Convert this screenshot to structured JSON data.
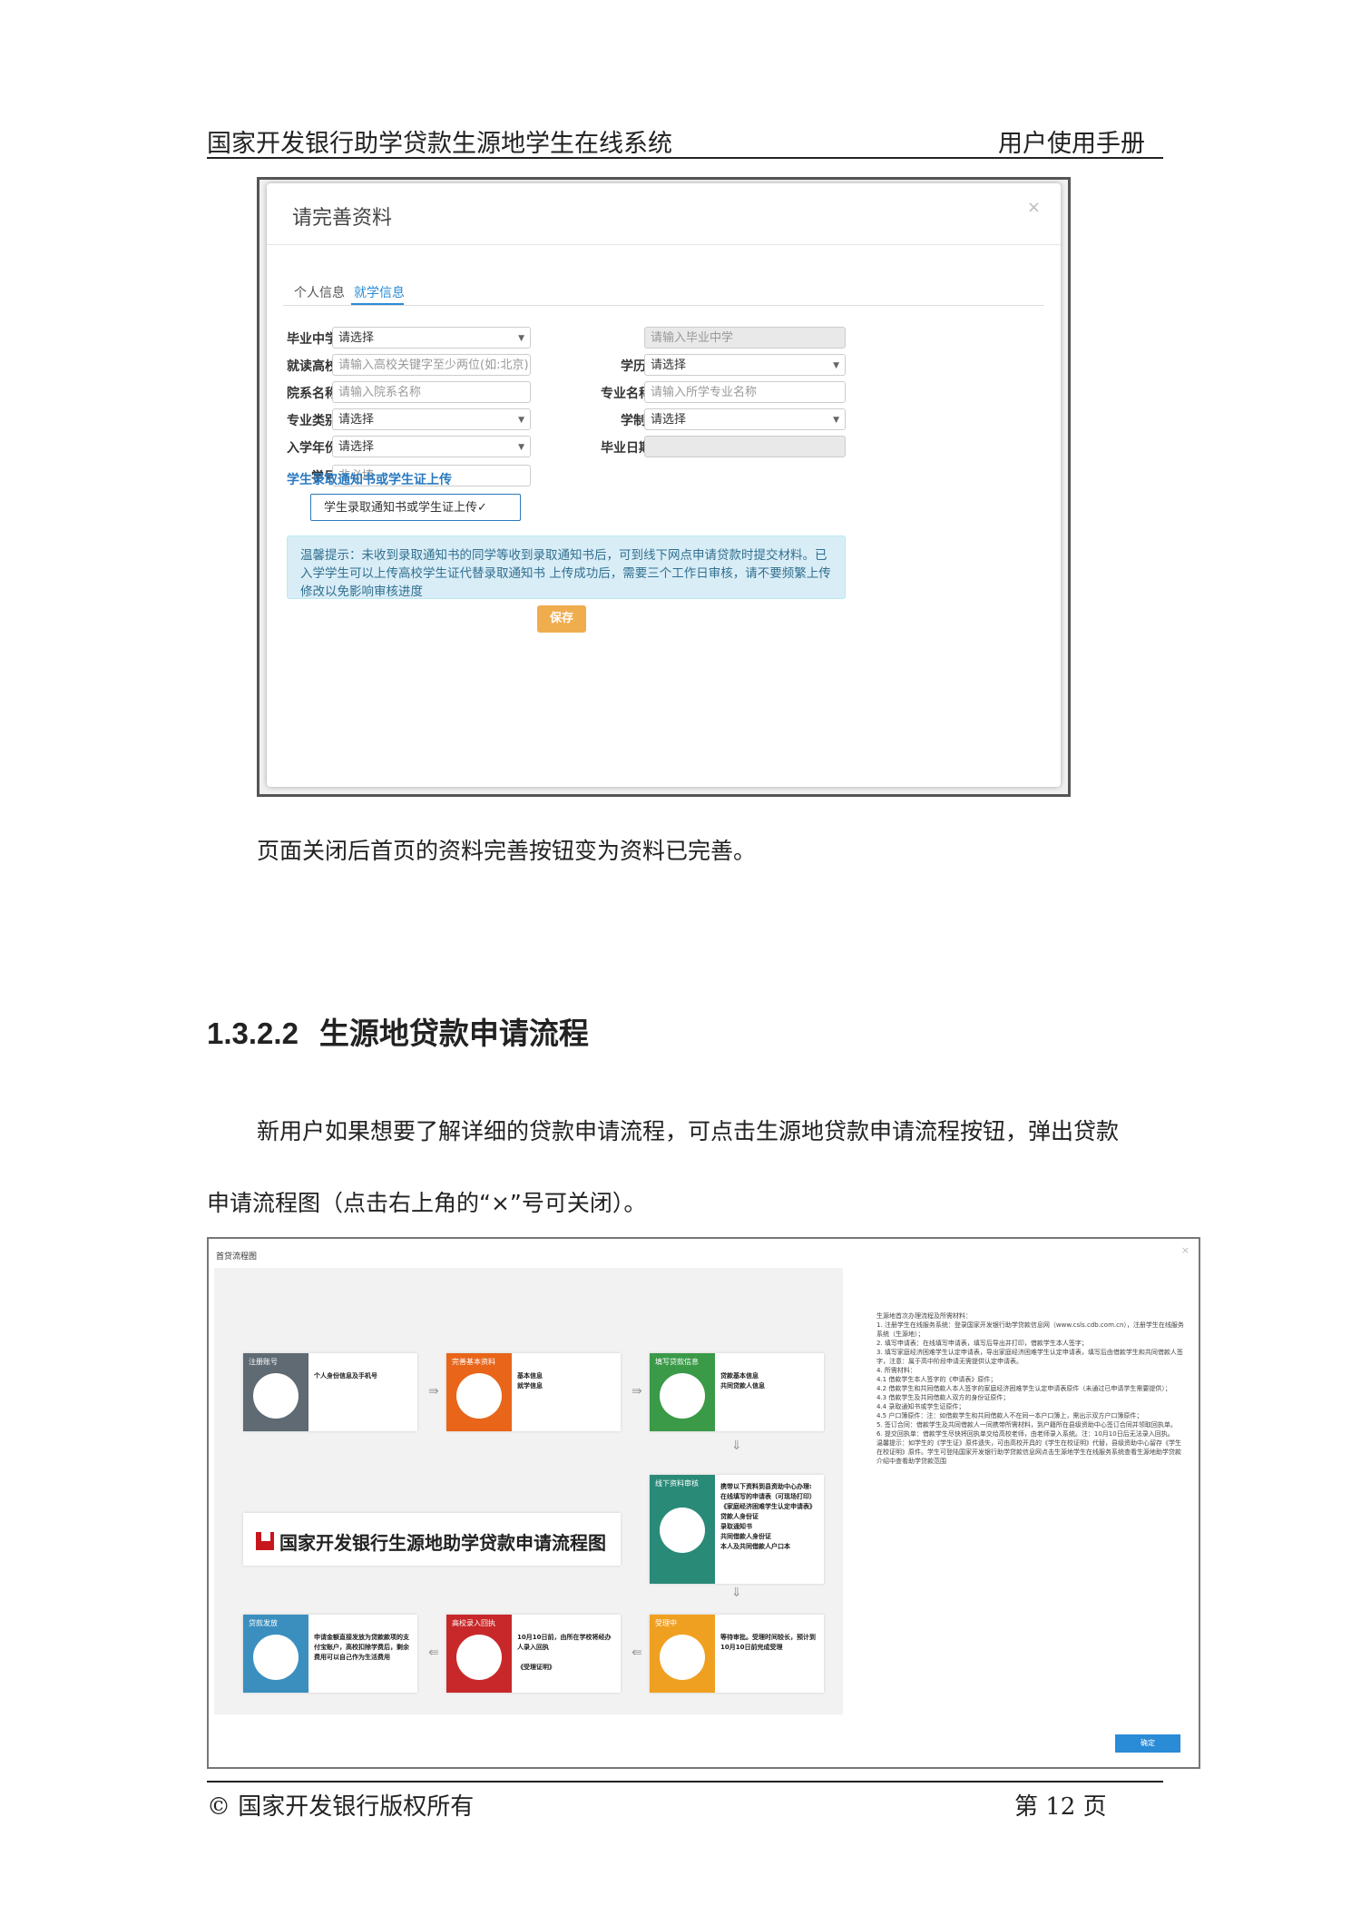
{
  "header": {
    "left": "国家开发银行助学贷款生源地学生在线系统",
    "right": "用户使用手册"
  },
  "modal": {
    "title": "请完善资料",
    "close": "×",
    "tabs": [
      "个人信息",
      "就学信息"
    ],
    "fields": {
      "middle_school": {
        "label": "毕业中学",
        "value": "请选择"
      },
      "middle_school_input": {
        "placeholder": "请输入毕业中学"
      },
      "college": {
        "label": "就读高校",
        "placeholder": "请输入高校关键字至少两位(如:北京)"
      },
      "education": {
        "label": "学历",
        "value": "请选择"
      },
      "department": {
        "label": "院系名称",
        "placeholder": "请输入院系名称"
      },
      "major": {
        "label": "专业名称",
        "placeholder": "请输入所学专业名称"
      },
      "major_type": {
        "label": "专业类别",
        "value": "请选择"
      },
      "duration": {
        "label": "学制",
        "value": "请选择"
      },
      "enroll_year": {
        "label": "入学年份",
        "value": "请选择"
      },
      "graduate_date": {
        "label": "毕业日期",
        "value": ""
      },
      "student_id": {
        "label": "学号",
        "placeholder": "非必填"
      }
    },
    "upload_section_title": "学生录取通知书或学生证上传",
    "upload_button": "学生录取通知书或学生证上传✓",
    "tip": "温馨提示：未收到录取通知书的同学等收到录取通知书后，可到线下网点申请贷款时提交材料。已入学学生可以上传高校学生证代替录取通知书 上传成功后，需要三个工作日审核，请不要频繁上传修改以免影响审核进度",
    "save": "保存"
  },
  "text": {
    "p1": "页面关闭后首页的资料完善按钮变为资料已完善。",
    "section_num": "1.3.2.2",
    "section_title": "生源地贷款申请流程",
    "p2": "新用户如果想要了解详细的贷款申请流程，可点击生源地贷款申请流程按钮，弹出贷款",
    "p3": "申请流程图（点击右上角的“×”号可关闭）。"
  },
  "flow": {
    "window_title": "首贷流程图",
    "close": "×",
    "banner": "国家开发银行生源地助学贷款申请流程图",
    "cards": [
      {
        "title": "注册账号",
        "text": "个人身份信息及手机号",
        "color": "#5f6a72",
        "icon": "tie-icon"
      },
      {
        "title": "完善基本资料",
        "text": "基本信息\n就学信息",
        "color": "#e8651a",
        "icon": "wrench-icon"
      },
      {
        "title": "填写贷款信息",
        "text": "贷款基本信息\n共同贷款人信息",
        "color": "#3a9a48",
        "icon": "pencil-icon"
      },
      {
        "title": "线下资料审核",
        "text": "携带以下资料到县资助中心办理:\n在线填写的申请表（可现场打印）\n《家庭经济困难学生认定申请表》\n贷款人身份证\n录取通知书\n共同借款人身份证\n本人及共同借款人户口本",
        "color": "#2a8a78",
        "icon": "stamp-icon"
      },
      {
        "title": "受理中",
        "text": "等待审批。受理时间较长，预计到10月10日前完成受理",
        "color": "#f0a020",
        "icon": "toggle-icon"
      },
      {
        "title": "高校录入回执",
        "text": "10月10日前，由所在学校将经办人录入回执\n\n《受理证明》",
        "color": "#c8282a",
        "icon": "printer-icon"
      },
      {
        "title": "贷款发放",
        "text": "申请金额直接发放为贷款款项的支付宝账户，高校扣除学费后，剩余费用可以自己作为生活费用",
        "color": "#3a8fbf",
        "icon": "card-icon"
      }
    ],
    "side_text": "生源地首次办理流程及所需材料：\n1. 注册学生在线服务系统：登录国家开发银行助学贷款信息网（www.csls.cdb.com.cn），注册学生在线服务系统（生源地）；\n2. 填写申请表：在线填写申请表，填写后导出并打印，借款学生本人签字；\n3. 填写家庭经济困难学生认定申请表，导出家庭经济困难学生认定申请表，填写后由借款学生和共同借款人签字，注意：属于高中阶段申请无需提供认定申请表。\n4. 所需材料：\n4.1 借款学生本人签字的《申请表》原件；\n4.2 借款学生和共同借款人本人签字的家庭经济困难学生认定申请表原件（未通过已申请学生需要提供）；\n4.3 借款学生及共同借款人双方的身份证原件；\n4.4 录取通知书或学生证原件；\n4.5 户口簿原件：注：如借款学生和共同借款人不在同一本户口簿上，需出示双方户口簿原件；\n5. 签订合同：借款学生及共同借款人一同携带所需材料，到户籍所在县级资助中心签订合同并领取回执单。\n6. 提交回执单：借款学生尽快将回执单交给高校老师，由老师录入系统。注：10月10日后无法录入回执。\n温馨提示：如学生的《学生证》原件遗失，可由高校开具的《学生在校证明》代替，县级资助中心留存《学生在校证明》原件。学生可登陆国家开发银行助学贷款信息网点击生源地学生在线服务系统查看生源地助学贷款介绍中查看助学贷款范围",
    "ok": "确定"
  },
  "footer": {
    "left": "©  国家开发银行版权所有",
    "right": "第 12 页"
  }
}
